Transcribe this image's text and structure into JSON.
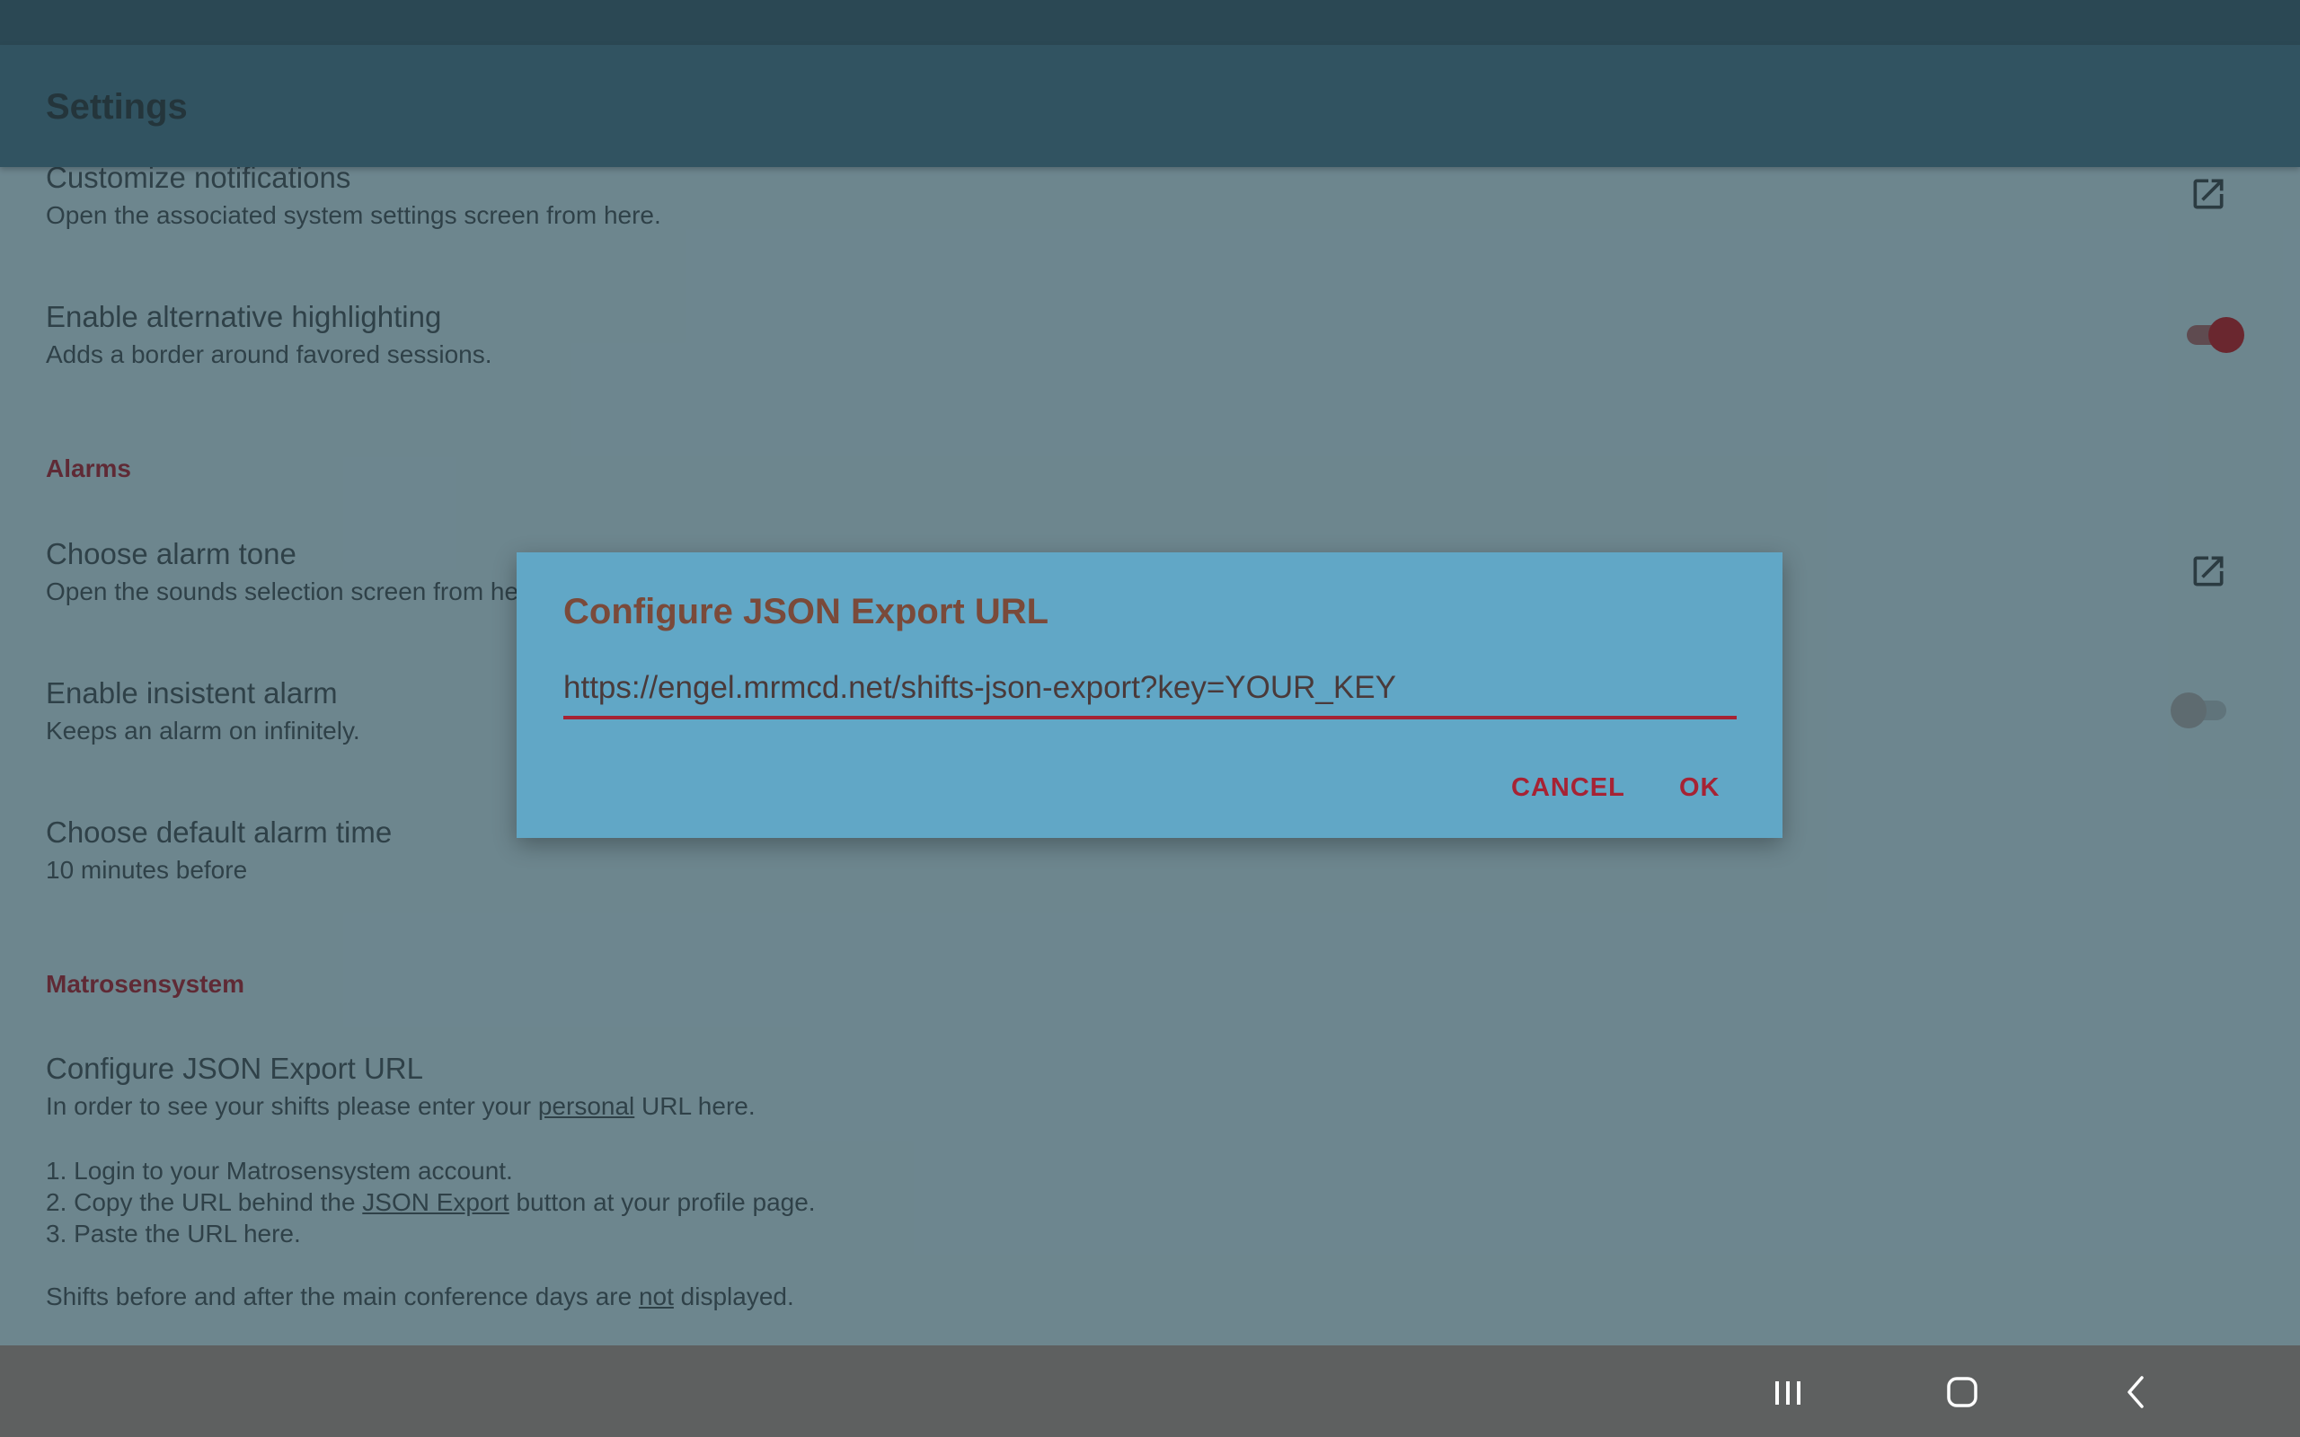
{
  "app": {
    "title": "Settings"
  },
  "prefs": {
    "notifications": {
      "title": "Customize notifications",
      "summary": "Open the associated system settings screen from here."
    },
    "highlighting": {
      "title": "Enable alternative highlighting",
      "summary": "Adds a border around favored sessions.",
      "enabled": true
    },
    "alarms_category": "Alarms",
    "alarm_tone": {
      "title": "Choose alarm tone",
      "summary": "Open the sounds selection screen from here."
    },
    "insistent_alarm": {
      "title": "Enable insistent alarm",
      "summary": "Keeps an alarm on infinitely.",
      "enabled": false
    },
    "alarm_time": {
      "title": "Choose default alarm time",
      "summary": "10 minutes before"
    },
    "matrosen_category": "Matrosensystem",
    "json_export": {
      "title": "Configure JSON Export URL",
      "summary_pre": "In order to see your shifts please enter your ",
      "summary_u": "personal",
      "summary_post": " URL here.",
      "step1": "1. Login to your Matrosensystem account.",
      "step2_pre": "2. Copy the URL behind the ",
      "step2_u": "JSON Export",
      "step2_post": " button at your profile page.",
      "step3": "3. Paste the URL here.",
      "note_pre": "Shifts before and after the main conference days are ",
      "note_u": "not",
      "note_post": " displayed."
    }
  },
  "dialog": {
    "title": "Configure JSON Export URL",
    "url_value": "https://engel.mrmcd.net/shifts-json-export?key=YOUR_KEY",
    "cancel_label": "CANCEL",
    "ok_label": "OK"
  },
  "icons": {
    "external": "open-external-icon",
    "recents": "recent-apps-icon",
    "home": "home-icon",
    "back": "back-icon"
  },
  "colors": {
    "accent": "#a62334",
    "toolbar": "#2e5565",
    "dialog_bg": "#61a7c6"
  }
}
